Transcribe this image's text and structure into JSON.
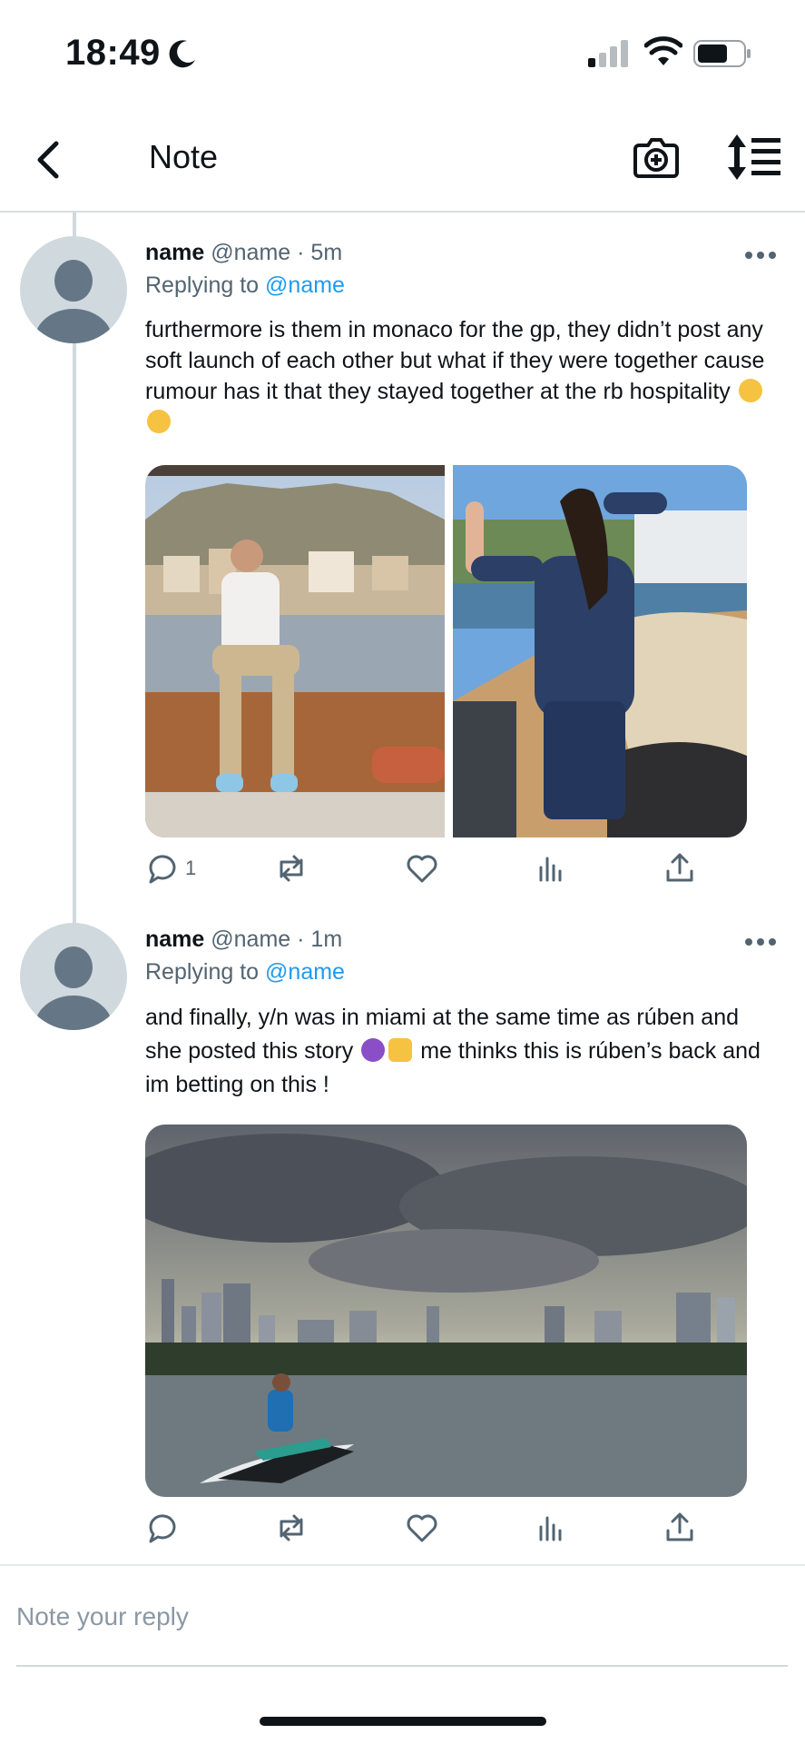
{
  "status_bar": {
    "time": "18:49",
    "icons": [
      "moon-icon",
      "cellular-signal-icon",
      "wifi-icon",
      "battery-icon"
    ]
  },
  "nav": {
    "title": "Note",
    "icons": [
      "back-arrow-icon",
      "camera-plus-icon",
      "sort-icon"
    ]
  },
  "tweets": [
    {
      "name": "name",
      "handle": "@name",
      "time": "· 5m",
      "replying_prefix": "Replying to",
      "replying_to": "@name",
      "text": "furthermore is them in monaco for the gp, they didn’t post any soft launch of each other but what if they were together cause rumour has it that they stayed together at the rb hospitality",
      "emoji": [
        "🤓",
        "🤓"
      ],
      "media": [
        "photo-man-monaco",
        "photo-woman-boat"
      ],
      "reply_count": "1"
    },
    {
      "name": "name",
      "handle": "@name",
      "time": "· 1m",
      "replying_prefix": "Replying to",
      "replying_to": "@name",
      "text_part1": "and finally, y/n was in miami at the same time as rúben and she posted this story",
      "emoji": [
        "😈",
        "🙏"
      ],
      "text_part2": "me thinks this is rúben’s back and im betting on this !",
      "media": [
        "photo-jetski-miami"
      ],
      "reply_count": ""
    }
  ],
  "composer": {
    "placeholder": "Note your reply"
  },
  "colors": {
    "accent": "#1d9bf0",
    "text": "#0f1419",
    "muted": "#536471",
    "avatar_bg": "#cfd9de",
    "avatar_fg": "#657786"
  }
}
